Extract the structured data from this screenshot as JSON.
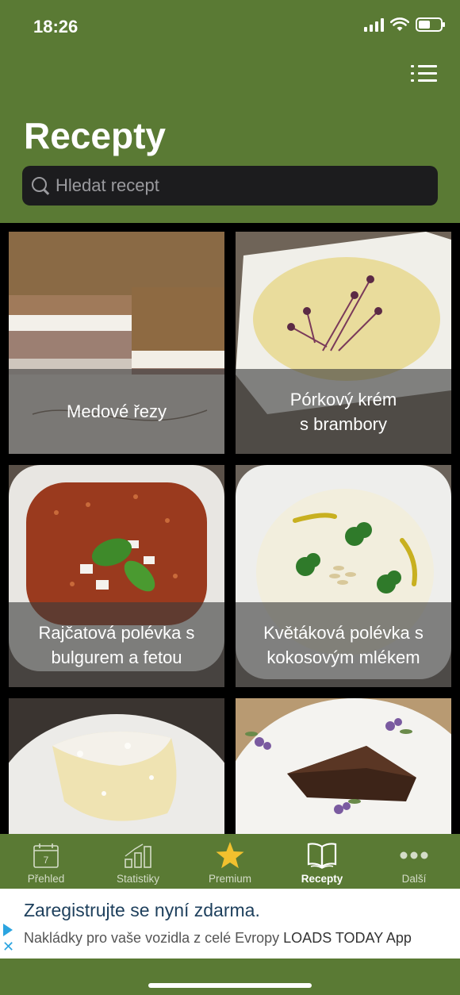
{
  "status": {
    "time": "18:26"
  },
  "header": {
    "title": "Recepty"
  },
  "search": {
    "placeholder": "Hledat recept"
  },
  "recipes": [
    {
      "title": "Medové řezy"
    },
    {
      "title": "Pórkový krém\ns brambory"
    },
    {
      "title": "Rajčatová polévka s\nbulgurem a fetou"
    },
    {
      "title": "Květáková polévka s\nkokosovým mlékem"
    },
    {
      "title": ""
    },
    {
      "title": ""
    }
  ],
  "tabs": [
    {
      "label": "Přehled",
      "icon": "calendar-icon",
      "badge": "7"
    },
    {
      "label": "Statistiky",
      "icon": "bar-chart-icon"
    },
    {
      "label": "Premium",
      "icon": "star-icon"
    },
    {
      "label": "Recepty",
      "icon": "book-icon",
      "active": true
    },
    {
      "label": "Další",
      "icon": "more-icon"
    }
  ],
  "ad": {
    "title": "Zaregistrujte se nyní zdarma.",
    "text": "Nakládky pro vaše vozidla z celé Evropy",
    "brand": "LOADS TODAY App"
  },
  "colors": {
    "brand_green": "#5a7a34",
    "star": "#f2c12e"
  }
}
